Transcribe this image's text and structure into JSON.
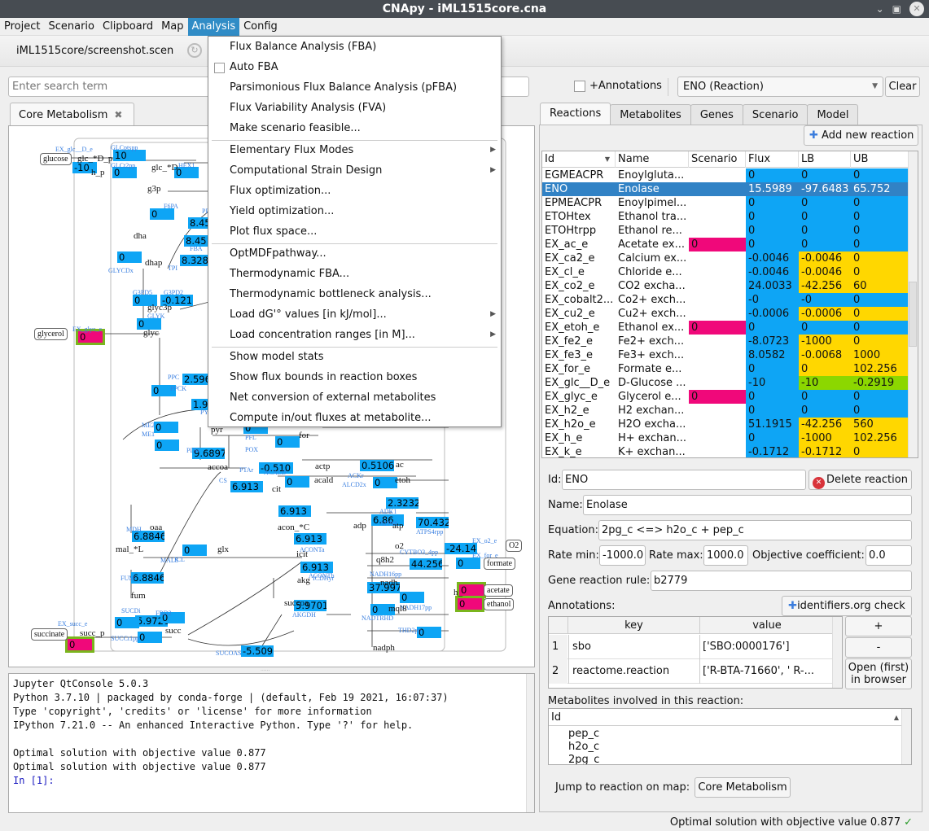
{
  "window": {
    "title": "CNApy - iML1515core.cna"
  },
  "menubar": [
    "Project",
    "Scenario",
    "Clipboard",
    "Map",
    "Analysis",
    "Config"
  ],
  "toolbar": {
    "scenario_file": "iML1515core/screenshot.scen"
  },
  "search": {
    "placeholder": "Enter search term",
    "annotations_label": "+Annotations",
    "selected": "ENO (Reaction)",
    "clear_label": "Clear"
  },
  "map_tab": {
    "label": "Core Metabolism"
  },
  "analysis_menu": {
    "items": [
      {
        "label": "Flux Balance Analysis (FBA)"
      },
      {
        "label": "Auto FBA",
        "checkbox": true
      },
      {
        "label": "Parsimonious Flux Balance Analysis (pFBA)"
      },
      {
        "label": "Flux Variability Analysis (FVA)"
      },
      {
        "label": "Make scenario feasible..."
      },
      {
        "label": "Elementary Flux Modes",
        "submenu": true
      },
      {
        "label": "Computational Strain Design",
        "submenu": true
      },
      {
        "label": "Flux optimization..."
      },
      {
        "label": "Yield optimization..."
      },
      {
        "label": "Plot flux space..."
      },
      {
        "label": "OptMDFpathway..."
      },
      {
        "label": "Thermodynamic FBA..."
      },
      {
        "label": "Thermodynamic bottleneck analysis..."
      },
      {
        "label": "Load dG'° values [in kJ/mol]...",
        "submenu": true
      },
      {
        "label": "Load concentration ranges [in M]...",
        "submenu": true
      },
      {
        "label": "Show model stats"
      },
      {
        "label": "Show flux bounds in reaction boxes"
      },
      {
        "label": "Net conversion of external metabolites"
      },
      {
        "label": "Compute in/out fluxes at metabolite..."
      }
    ]
  },
  "map": {
    "reaction_boxes": [
      {
        "id": "GLCptspp",
        "value": "10"
      },
      {
        "id": "EX_glc__D_e",
        "value": "-10"
      },
      {
        "id": "GLCt2pp",
        "value": "0"
      },
      {
        "id": "HEX1",
        "value": "0"
      },
      {
        "id": "F6PA",
        "value": "0"
      },
      {
        "id": "PFK",
        "value": "8.45"
      },
      {
        "id": "FBA",
        "value": "8.451"
      },
      {
        "id": "TPI",
        "value": "8.3282"
      },
      {
        "id": "GLYCDx",
        "value": "0"
      },
      {
        "id": "G3PD5",
        "value": "0"
      },
      {
        "id": "G3PD2",
        "value": "-0.121"
      },
      {
        "id": "GLYK",
        "value": "0"
      },
      {
        "id": "EX_glyc_e",
        "value": "0",
        "scenario": true
      },
      {
        "id": "PPC",
        "value": "2.596"
      },
      {
        "id": "PPCK",
        "value": "0"
      },
      {
        "id": "PYK",
        "value": "1.92"
      },
      {
        "id": "ME2",
        "value": "0"
      },
      {
        "id": "ME1",
        "value": "0"
      },
      {
        "id": "PDH",
        "value": "9.6897"
      },
      {
        "id": "PFL",
        "value": "0"
      },
      {
        "id": "POX",
        "value": "0"
      },
      {
        "id": "PTAr",
        "value": "-0.510"
      },
      {
        "id": "ACKr",
        "value": "0.5106"
      },
      {
        "id": "ACALD",
        "value": "0"
      },
      {
        "id": "ALCD2x",
        "value": "0"
      },
      {
        "id": "CS",
        "value": "6.913"
      },
      {
        "id": "ACONTa",
        "value": "6.913"
      },
      {
        "id": "ACONTb",
        "value": "6.913"
      },
      {
        "id": "ICDHyr",
        "value": "6.913"
      },
      {
        "id": "AKGDH",
        "value": "5.9701"
      },
      {
        "id": "SUCOAS",
        "value": "-5.509"
      },
      {
        "id": "ICL",
        "value": "0"
      },
      {
        "id": "MALS",
        "value": "0"
      },
      {
        "id": "MDH",
        "value": "6.8846"
      },
      {
        "id": "FUM",
        "value": "6.8846"
      },
      {
        "id": "SUCDi",
        "value": "5.9726"
      },
      {
        "id": "FRD2",
        "value": "0"
      },
      {
        "id": "SUCCt2_2pp",
        "value": "0"
      },
      {
        "id": "SUCCt1pp",
        "value": "0"
      },
      {
        "id": "EX_succ_e",
        "value": "0",
        "scenario": true
      },
      {
        "id": "EX_for_e",
        "value": "0"
      },
      {
        "id": "EX_ac_e",
        "value": "0",
        "scenario": true
      },
      {
        "id": "EX_etoh_e",
        "value": "0",
        "scenario": true
      },
      {
        "id": "ADK1",
        "value": "2.3232"
      },
      {
        "id": "ATPM",
        "value": "6.86"
      },
      {
        "id": "ATPS4rpp",
        "value": "70.432"
      },
      {
        "id": "EX_o2_e",
        "value": "-24.14"
      },
      {
        "id": "CYTBO3_4pp",
        "value": "44.256"
      },
      {
        "id": "NADH16pp",
        "value": "37.997"
      },
      {
        "id": "NADH17pp",
        "value": "0"
      },
      {
        "id": "NADTRHD",
        "value": "0"
      },
      {
        "id": "THD2pp",
        "value": "0"
      }
    ],
    "metabolites": [
      "glucose",
      "glc__D_p",
      "glc__D",
      "h_p",
      "g3p",
      "dha",
      "dhap",
      "glyc3p",
      "glyc",
      "glycerol",
      "pyr",
      "for",
      "accoa",
      "actp",
      "ac",
      "acald",
      "etoh",
      "cit",
      "acon__C",
      "icit",
      "akg",
      "succoa",
      "glx",
      "oaa",
      "mal__L",
      "fum",
      "succ",
      "succ_p",
      "succinate",
      "formate",
      "acetate",
      "ethanol",
      "adp",
      "atp",
      "o2",
      "O2",
      "q8h2",
      "nadh",
      "mql8",
      "nadph",
      "h_"
    ]
  },
  "console": {
    "lines": [
      "Jupyter QtConsole 5.0.3",
      "Python 3.7.10 | packaged by conda-forge | (default, Feb 19 2021, 16:07:37)",
      "Type 'copyright', 'credits' or 'license' for more information",
      "IPython 7.21.0 -- An enhanced Interactive Python. Type '?' for help.",
      "",
      "Optimal solution with objective value 0.877",
      "Optimal solution with objective value 0.877"
    ],
    "prompt": "In [1]:"
  },
  "right_tabs": [
    "Reactions",
    "Metabolites",
    "Genes",
    "Scenario",
    "Model"
  ],
  "reactions": {
    "add_label": "Add new reaction",
    "columns": [
      "Id",
      "Name",
      "Scenario",
      "Flux",
      "LB",
      "UB"
    ],
    "rows": [
      {
        "id": "EGMEACPR",
        "name": "Enoylgluta...",
        "scenario": "",
        "flux": "0",
        "lb": "0",
        "ub": "0",
        "bc": "blue"
      },
      {
        "id": "ENO",
        "name": "Enolase",
        "scenario": "",
        "flux": "15.5989",
        "lb": "-97.6483",
        "ub": "65.752",
        "bc": "blue",
        "selected": true
      },
      {
        "id": "EPMEACPR",
        "name": "Enoylpimel...",
        "scenario": "",
        "flux": "0",
        "lb": "0",
        "ub": "0",
        "bc": "blue"
      },
      {
        "id": "ETOHtex",
        "name": "Ethanol tra...",
        "scenario": "",
        "flux": "0",
        "lb": "0",
        "ub": "0",
        "bc": "blue"
      },
      {
        "id": "ETOHtrpp",
        "name": "Ethanol re...",
        "scenario": "",
        "flux": "0",
        "lb": "0",
        "ub": "0",
        "bc": "blue"
      },
      {
        "id": "EX_ac_e",
        "name": "Acetate ex...",
        "scenario": "0",
        "flux": "0",
        "lb": "0",
        "ub": "0",
        "bc": "blue"
      },
      {
        "id": "EX_ca2_e",
        "name": "Calcium ex...",
        "scenario": "",
        "flux": "-0.0046",
        "lb": "-0.0046",
        "ub": "0",
        "bc": "yellow"
      },
      {
        "id": "EX_cl_e",
        "name": "Chloride e...",
        "scenario": "",
        "flux": "-0.0046",
        "lb": "-0.0046",
        "ub": "0",
        "bc": "yellow"
      },
      {
        "id": "EX_co2_e",
        "name": "CO2 excha...",
        "scenario": "",
        "flux": "24.0033",
        "lb": "-42.256",
        "ub": "60",
        "bc": "yellow"
      },
      {
        "id": "EX_cobalt2...",
        "name": "Co2+ exch...",
        "scenario": "",
        "flux": "-0",
        "lb": "-0",
        "ub": "0",
        "bc": "blue"
      },
      {
        "id": "EX_cu2_e",
        "name": "Cu2+ exch...",
        "scenario": "",
        "flux": "-0.0006",
        "lb": "-0.0006",
        "ub": "0",
        "bc": "yellow"
      },
      {
        "id": "EX_etoh_e",
        "name": "Ethanol ex...",
        "scenario": "0",
        "flux": "0",
        "lb": "0",
        "ub": "0",
        "bc": "blue"
      },
      {
        "id": "EX_fe2_e",
        "name": "Fe2+ exch...",
        "scenario": "",
        "flux": "-8.0723",
        "lb": "-1000",
        "ub": "0",
        "bc": "yellow"
      },
      {
        "id": "EX_fe3_e",
        "name": "Fe3+ exch...",
        "scenario": "",
        "flux": "8.0582",
        "lb": "-0.0068",
        "ub": "1000",
        "bc": "yellow"
      },
      {
        "id": "EX_for_e",
        "name": "Formate e...",
        "scenario": "",
        "flux": "0",
        "lb": "0",
        "ub": "102.256",
        "bc": "yellow"
      },
      {
        "id": "EX_glc__D_e",
        "name": "D-Glucose ...",
        "scenario": "",
        "flux": "-10",
        "lb": "-10",
        "ub": "-0.2919",
        "bc": "green"
      },
      {
        "id": "EX_glyc_e",
        "name": "Glycerol e...",
        "scenario": "0",
        "flux": "0",
        "lb": "0",
        "ub": "0",
        "bc": "blue"
      },
      {
        "id": "EX_h2_e",
        "name": "H2 exchan...",
        "scenario": "",
        "flux": "0",
        "lb": "0",
        "ub": "0",
        "bc": "blue"
      },
      {
        "id": "EX_h2o_e",
        "name": "H2O excha...",
        "scenario": "",
        "flux": "51.1915",
        "lb": "-42.256",
        "ub": "560",
        "bc": "yellow"
      },
      {
        "id": "EX_h_e",
        "name": "H+ exchan...",
        "scenario": "",
        "flux": "0",
        "lb": "-1000",
        "ub": "102.256",
        "bc": "yellow"
      },
      {
        "id": "EX_k_e",
        "name": "K+ exchan...",
        "scenario": "",
        "flux": "-0.1712",
        "lb": "-0.1712",
        "ub": "0",
        "bc": "yellow"
      }
    ]
  },
  "reaction_form": {
    "id_label": "Id:",
    "id": "ENO",
    "delete_label": "Delete reaction",
    "name_label": "Name:",
    "name": "Enolase",
    "equation_label": "Equation:",
    "equation": "2pg_c <=> h2o_c + pep_c",
    "rate_min_label": "Rate min:",
    "rate_min": "-1000.0",
    "rate_max_label": "Rate max:",
    "rate_max": "1000.0",
    "objective_label": "Objective coefficient:",
    "objective": "0.0",
    "gpr_label": "Gene reaction rule:",
    "gpr": "b2779",
    "annotations_label": "Annotations:",
    "identifiers_label": "identifiers.org check",
    "annotation_columns": [
      "key",
      "value"
    ],
    "annotations": [
      {
        "n": "1",
        "key": "sbo",
        "value": "['SBO:0000176']"
      },
      {
        "n": "2",
        "key": "reactome.reaction",
        "value": "['R-BTA-71660', ' R-..."
      }
    ],
    "add_ann": "+",
    "remove_ann": "-",
    "open_browser": "Open (first)\nin browser",
    "metabolites_label": "Metabolites involved in this reaction:",
    "metabolites_column": "Id",
    "metabolites": [
      "pep_c",
      "h2o_c",
      "2pg_c"
    ],
    "jump_label": "Jump to reaction on map:",
    "jump_button": "Core Metabolism"
  },
  "status": {
    "message": "Optimal solution with objective value 0.877"
  },
  "colors": {
    "flux_blue": "#0ea5f5",
    "bound_yellow": "#ffd700",
    "bound_green": "#8cd700",
    "scenario_pink": "#f0087a",
    "selection": "#3182c5",
    "menu_highlight": "#308cc6"
  }
}
